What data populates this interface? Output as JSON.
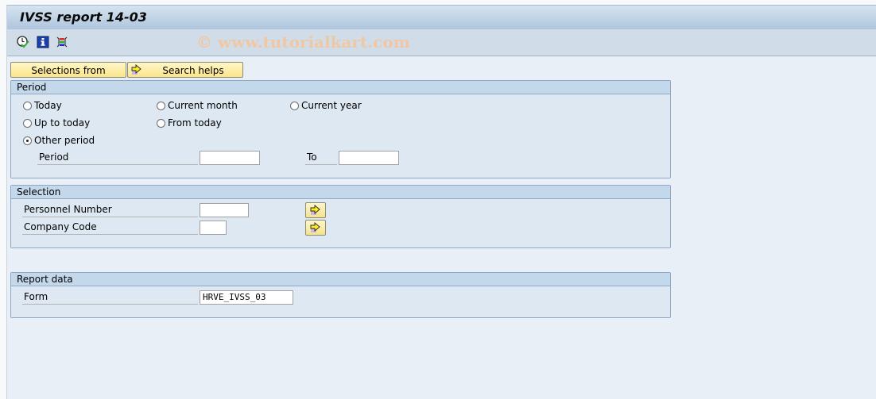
{
  "window": {
    "title": "IVSS report 14-03"
  },
  "toolbar": {
    "icons": [
      "execute-clock-icon",
      "info-icon",
      "selection-options-icon"
    ],
    "watermark": "© www.tutorialkart.com"
  },
  "buttons": {
    "selections_from": "Selections from",
    "search_helps": "Search helps"
  },
  "period_group": {
    "title": "Period",
    "radios": [
      {
        "label": "Today",
        "checked": false
      },
      {
        "label": "Current month",
        "checked": false
      },
      {
        "label": "Current year",
        "checked": false
      },
      {
        "label": "Up to today",
        "checked": false
      },
      {
        "label": "From today",
        "checked": false
      },
      {
        "label": "Other period",
        "checked": true
      }
    ],
    "period_label": "Period",
    "period_from_value": "",
    "to_label": "To",
    "period_to_value": ""
  },
  "selection_group": {
    "title": "Selection",
    "fields": [
      {
        "label": "Personnel Number",
        "value": ""
      },
      {
        "label": "Company Code",
        "value": ""
      }
    ]
  },
  "report_group": {
    "title": "Report data",
    "form_label": "Form",
    "form_value": "HRVE_IVSS_03"
  }
}
